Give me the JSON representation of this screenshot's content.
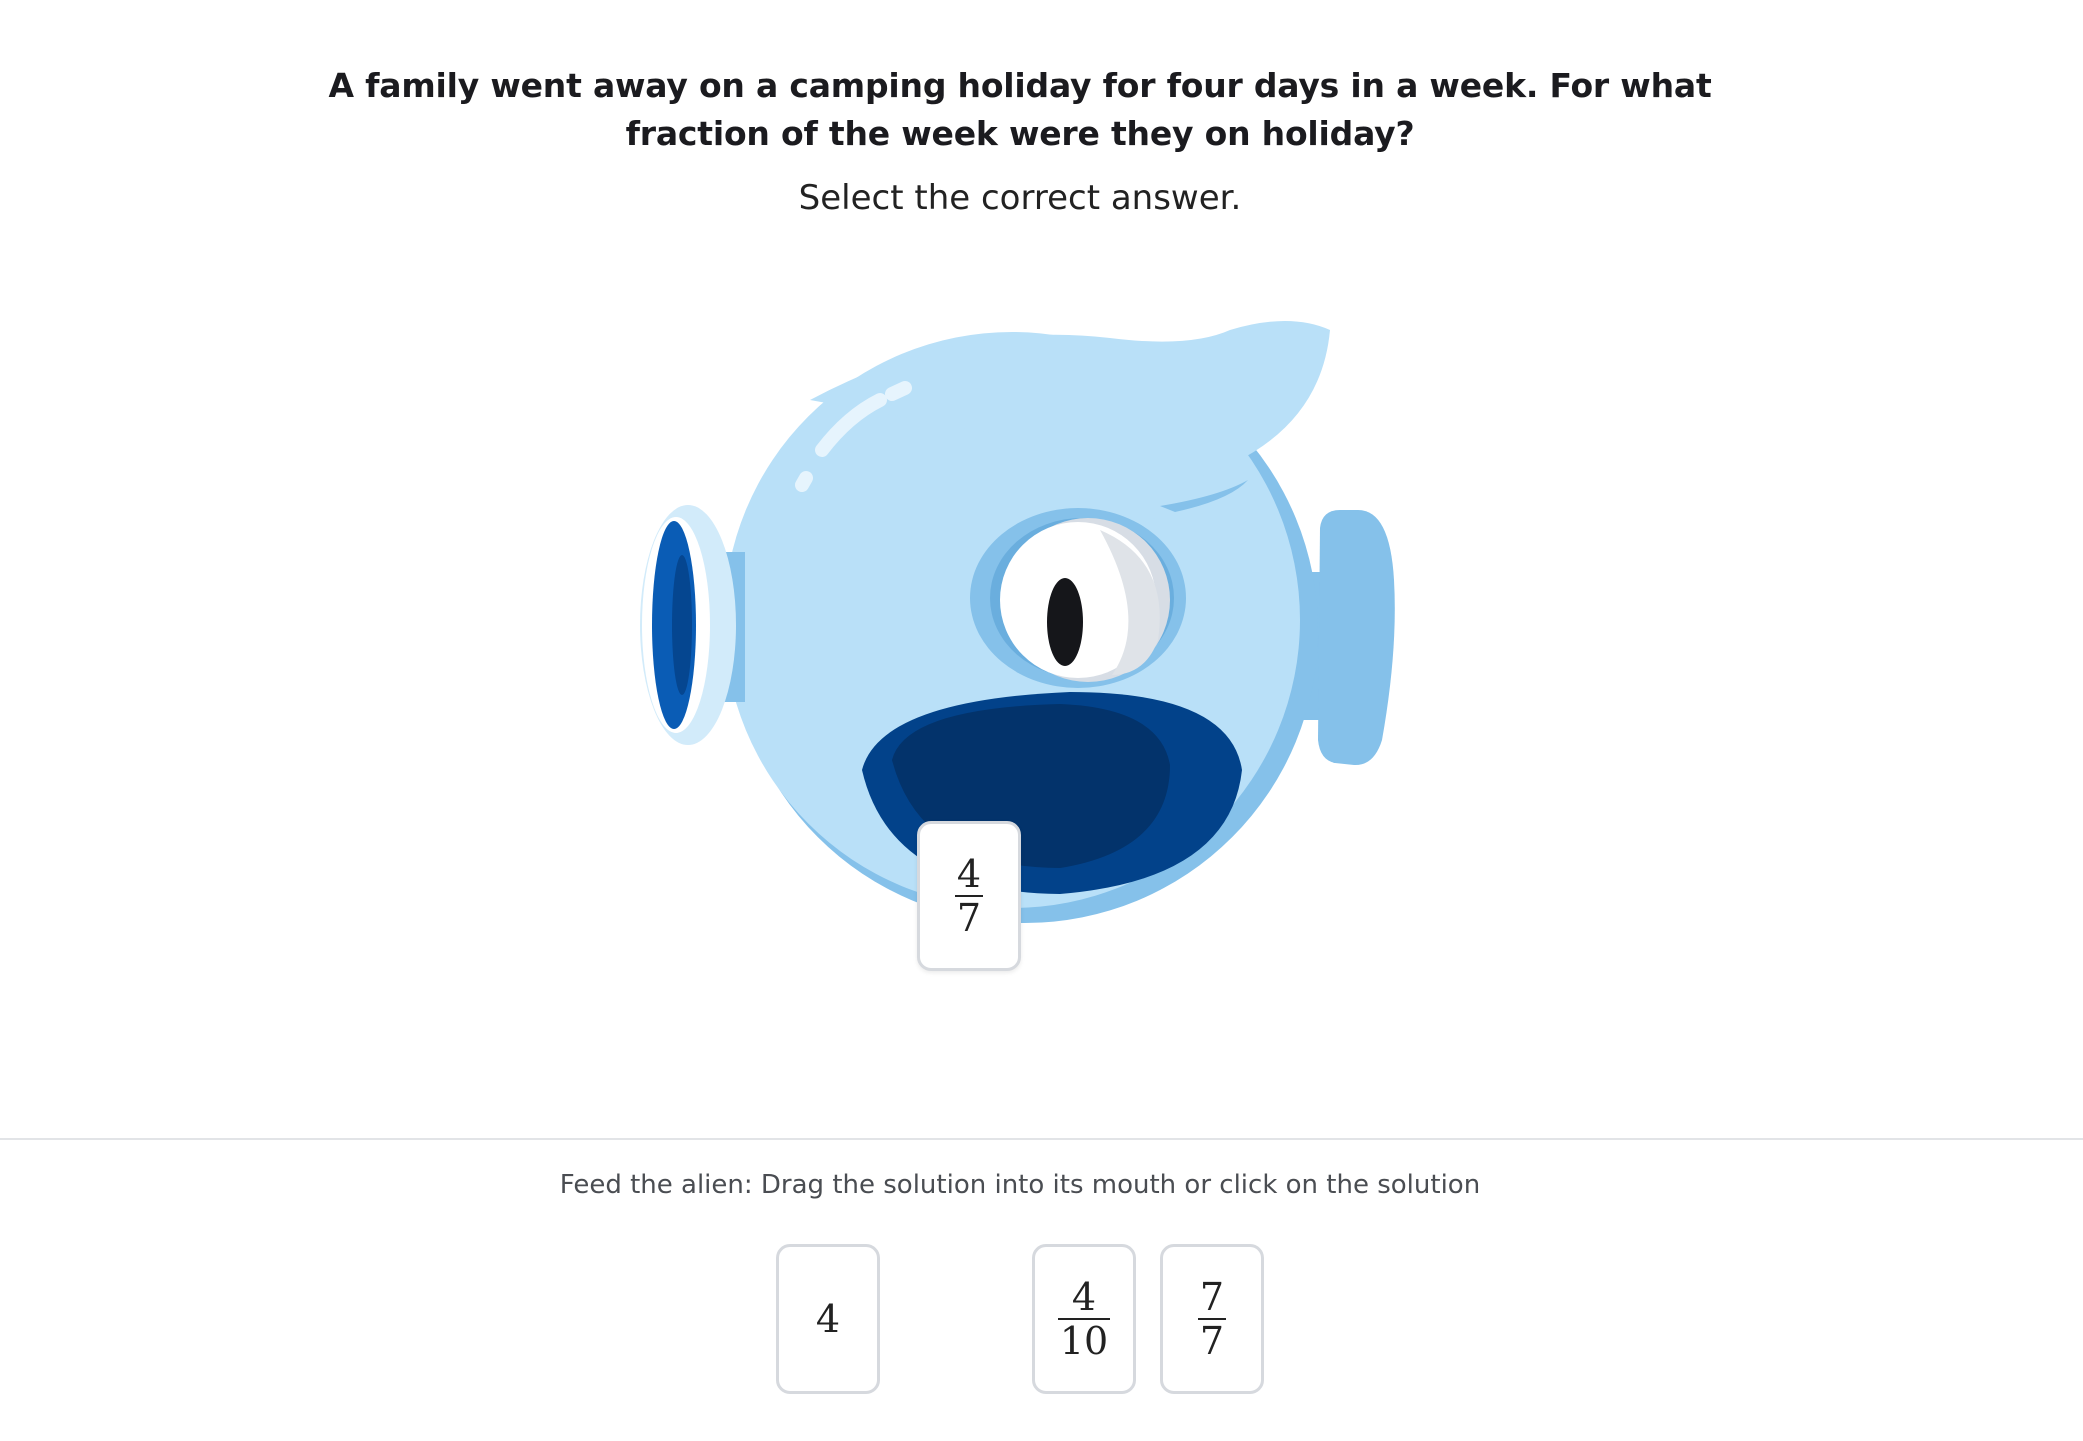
{
  "question": {
    "text": "A family went away on a camping holiday for four days in a week. For what fraction of the week were they on holiday?",
    "instruction": "Select the correct answer."
  },
  "alien": {
    "colors": {
      "body": "#b9e0f8",
      "shade": "#85c1ea",
      "mouth_outer": "#02428a",
      "mouth_inner": "#03336b",
      "ear_dark": "#0a5cb5",
      "pupil": "#15161a"
    },
    "in_mouth": {
      "numerator": "4",
      "denominator": "7"
    }
  },
  "footer": {
    "hint": "Feed the alien: Drag the solution into its mouth or click on the solution",
    "options": [
      {
        "value": "4"
      },
      {
        "numerator": "4",
        "denominator": "10"
      },
      {
        "numerator": "7",
        "denominator": "7"
      }
    ]
  }
}
